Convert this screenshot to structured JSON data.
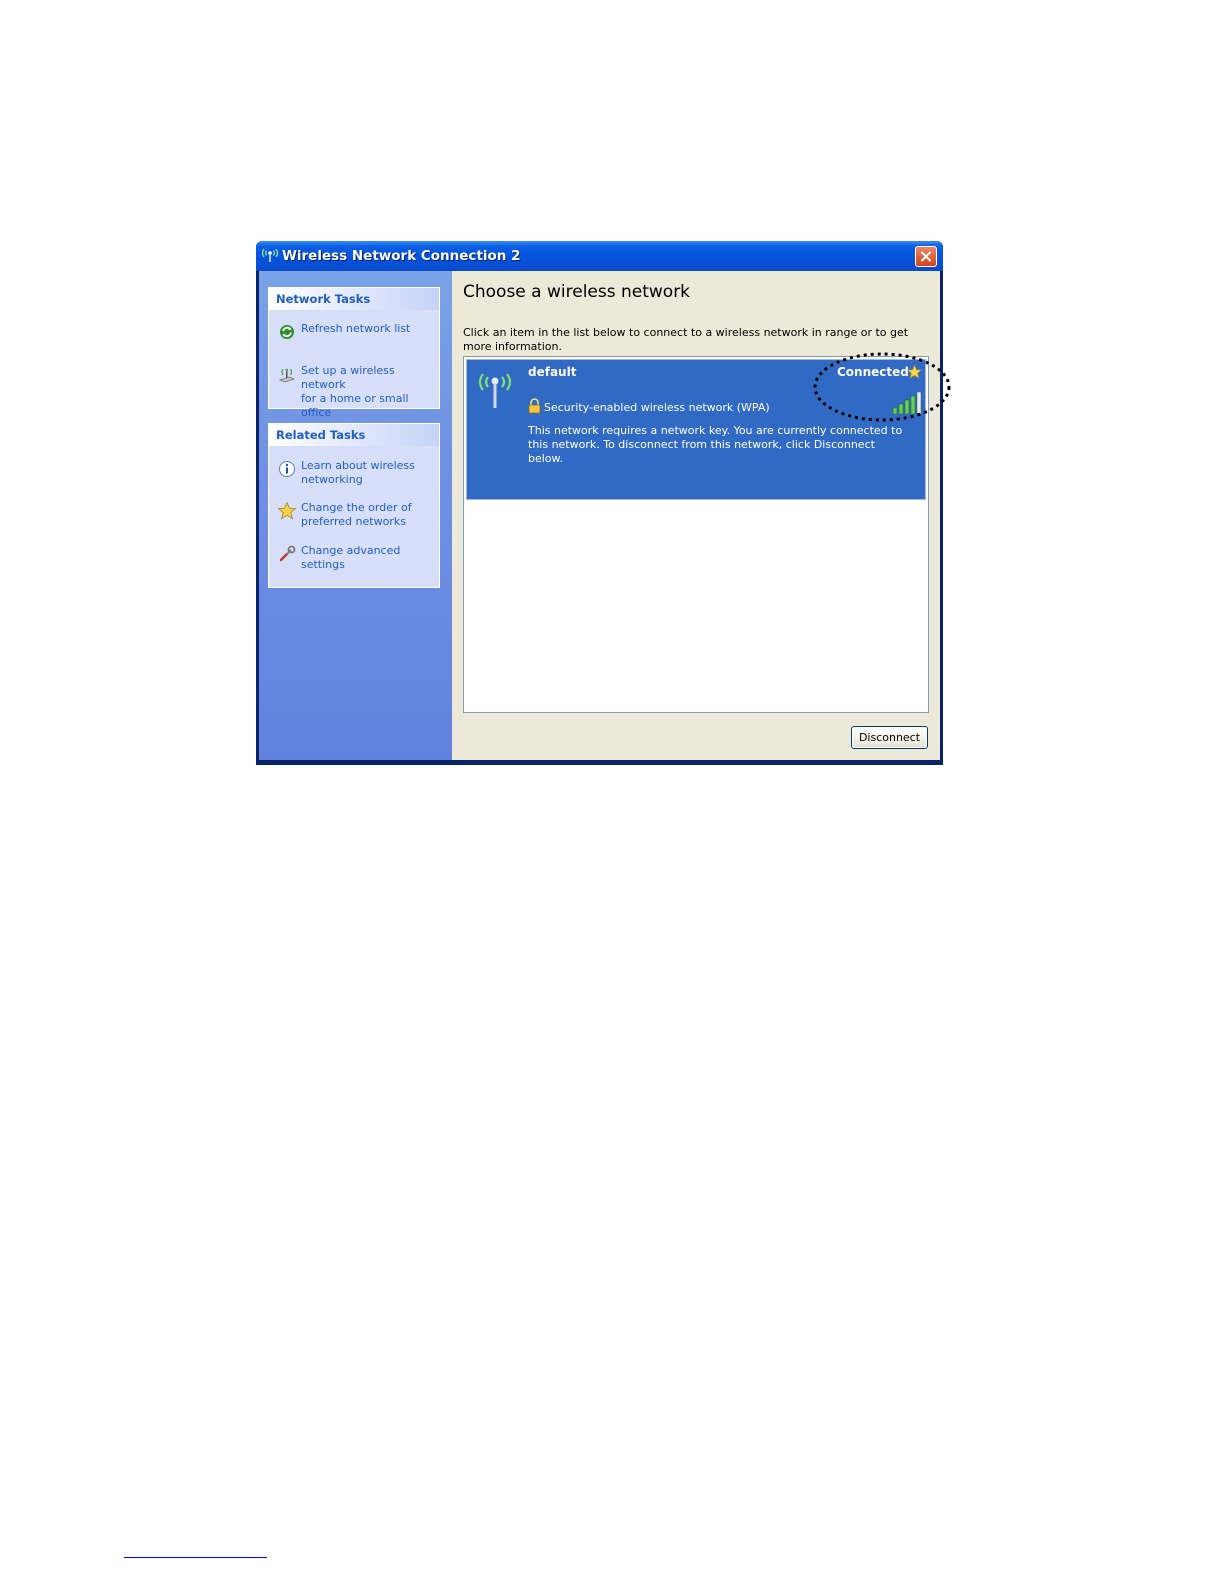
{
  "window": {
    "title": "Wireless Network Connection 2",
    "title_icon": "wireless-antenna-icon",
    "close_icon": "close-icon"
  },
  "sidebar": {
    "network_tasks": {
      "heading": "Network Tasks",
      "items": [
        {
          "label": "Refresh network list",
          "icon": "refresh-icon"
        },
        {
          "label": "Set up a wireless network\nfor a home or small office",
          "icon": "wireless-setup-icon"
        }
      ]
    },
    "related_tasks": {
      "heading": "Related Tasks",
      "items": [
        {
          "label": "Learn about wireless\nnetworking",
          "icon": "info-icon"
        },
        {
          "label": "Change the order of\npreferred networks",
          "icon": "star-icon"
        },
        {
          "label": "Change advanced\nsettings",
          "icon": "settings-icon"
        }
      ]
    }
  },
  "main": {
    "heading": "Choose a wireless network",
    "instruction": "Click an item in the list below to connect to a wireless network in range or to get more information.",
    "networks": [
      {
        "name": "default",
        "status": "Connected",
        "security": "Security-enabled wireless network (WPA)",
        "description": "This network requires a network key. You are currently connected to this network. To disconnect from this network, click Disconnect below.",
        "signal_bars": 5,
        "signal_strength_bars_filled": 4
      }
    ],
    "disconnect_button": "Disconnect"
  },
  "colors": {
    "selection": "#316ac5",
    "link": "#215dc6",
    "titlebar": "#0454de"
  }
}
